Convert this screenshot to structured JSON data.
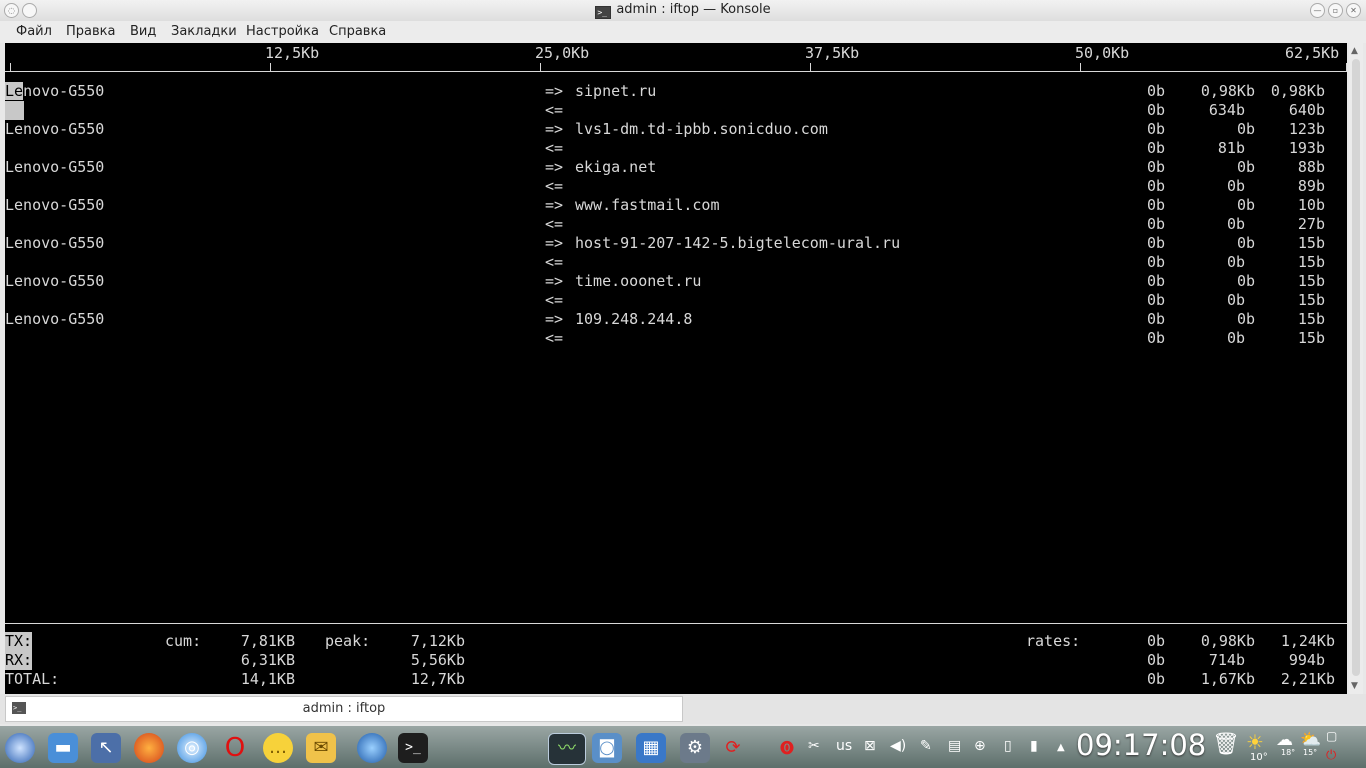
{
  "window": {
    "title": "admin : iftop — Konsole"
  },
  "menu": [
    "Файл",
    "Правка",
    "Вид",
    "Закладки",
    "Настройка",
    "Справка"
  ],
  "scale": [
    "12,5Kb",
    "25,0Kb",
    "37,5Kb",
    "50,0Kb",
    "62,5Kb"
  ],
  "connections": [
    {
      "host": "Lenovo-G550",
      "dest": "sipnet.ru",
      "out": [
        "0b",
        "0,98Kb",
        "0,98Kb"
      ],
      "in": [
        "0b",
        "634b",
        "640b"
      ]
    },
    {
      "host": "Lenovo-G550",
      "dest": "lvs1-dm.td-ipbb.sonicduo.com",
      "out": [
        "0b",
        "0b",
        "123b"
      ],
      "in": [
        "0b",
        "81b",
        "193b"
      ]
    },
    {
      "host": "Lenovo-G550",
      "dest": "ekiga.net",
      "out": [
        "0b",
        "0b",
        "88b"
      ],
      "in": [
        "0b",
        "0b",
        "89b"
      ]
    },
    {
      "host": "Lenovo-G550",
      "dest": "www.fastmail.com",
      "out": [
        "0b",
        "0b",
        "10b"
      ],
      "in": [
        "0b",
        "0b",
        "27b"
      ]
    },
    {
      "host": "Lenovo-G550",
      "dest": "host-91-207-142-5.bigtelecom-ural.ru",
      "out": [
        "0b",
        "0b",
        "15b"
      ],
      "in": [
        "0b",
        "0b",
        "15b"
      ]
    },
    {
      "host": "Lenovo-G550",
      "dest": "time.ooonet.ru",
      "out": [
        "0b",
        "0b",
        "15b"
      ],
      "in": [
        "0b",
        "0b",
        "15b"
      ]
    },
    {
      "host": "Lenovo-G550",
      "dest": "109.248.244.8",
      "out": [
        "0b",
        "0b",
        "15b"
      ],
      "in": [
        "0b",
        "0b",
        "15b"
      ]
    }
  ],
  "arrows": {
    "out": "=>",
    "in": "<="
  },
  "summary": {
    "labels": {
      "cum": "cum:",
      "peak": "peak:",
      "rates": "rates:"
    },
    "rows": [
      {
        "label": "TX:",
        "cum": "7,81KB",
        "peak": "7,12Kb",
        "rates": [
          "0b",
          "0,98Kb",
          "1,24Kb"
        ]
      },
      {
        "label": "RX:",
        "cum": "6,31KB",
        "peak": "5,56Kb",
        "rates": [
          "0b",
          "714b",
          "994b"
        ]
      },
      {
        "label": "TOTAL:",
        "cum": "14,1KB",
        "peak": "12,7Kb",
        "rates": [
          "0b",
          "1,67Kb",
          "2,21Kb"
        ]
      }
    ]
  },
  "tab": {
    "label": "admin : iftop"
  },
  "taskbar": {
    "clock": "09:17:08",
    "keyboard_layout": "us",
    "weather": [
      "10°",
      "18°",
      "15°"
    ]
  }
}
